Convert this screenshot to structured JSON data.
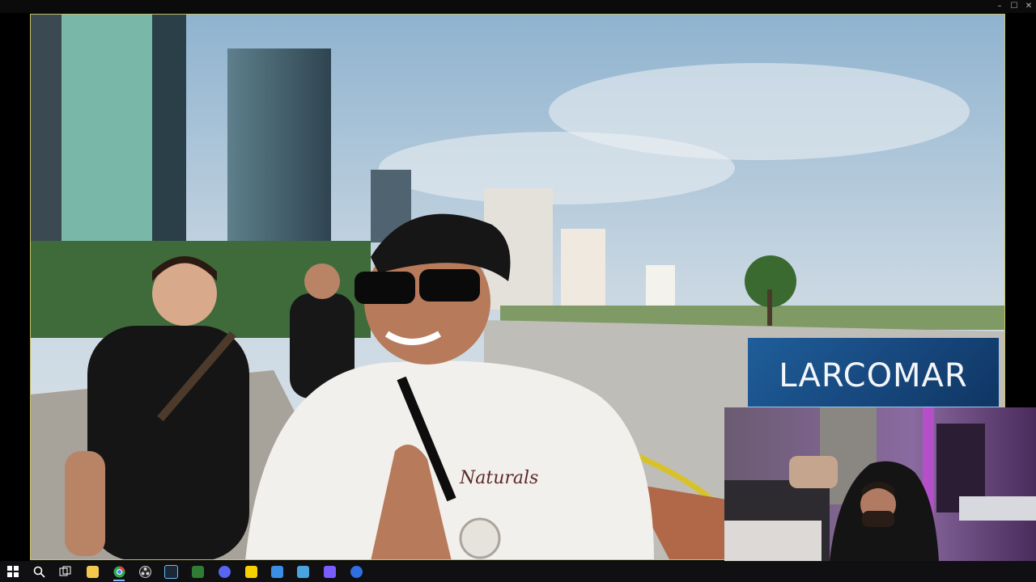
{
  "window": {
    "controls": [
      "–",
      "☐",
      "✕"
    ]
  },
  "video": {
    "lower_third_text": "LARCOMAR",
    "shirt_text": "Naturals"
  },
  "taskbar": {
    "icons": [
      {
        "name": "start-icon",
        "color": "#ffffff"
      },
      {
        "name": "search-icon",
        "color": "#ffffff"
      },
      {
        "name": "task-view-icon",
        "color": "#ffffff"
      },
      {
        "name": "file-explorer-icon",
        "color": "#f2c94c"
      },
      {
        "name": "chrome-icon",
        "color": "#34a853"
      },
      {
        "name": "obs-icon",
        "color": "#d0d0d0"
      },
      {
        "name": "steam-icon",
        "color": "#66c0f4"
      },
      {
        "name": "document-icon",
        "color": "#2e7d32"
      },
      {
        "name": "discord-icon",
        "color": "#5865f2"
      },
      {
        "name": "sticky-notes-icon",
        "color": "#f7d000"
      },
      {
        "name": "calendar-icon",
        "color": "#3a8ee6"
      },
      {
        "name": "calculator-icon",
        "color": "#4aa3df"
      },
      {
        "name": "grid-app-icon",
        "color": "#7b5cff"
      },
      {
        "name": "account-icon",
        "color": "#2f6fe0"
      }
    ]
  }
}
